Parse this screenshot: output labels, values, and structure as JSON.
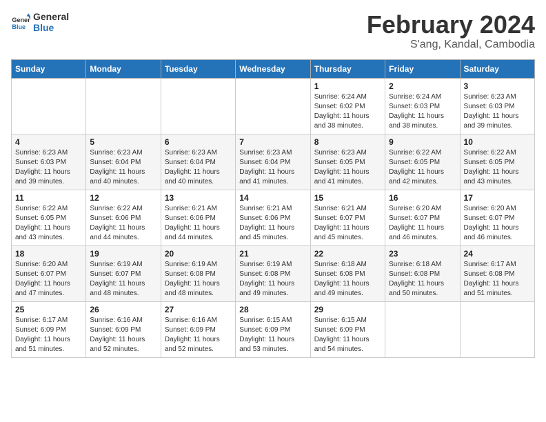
{
  "header": {
    "logo_line1": "General",
    "logo_line2": "Blue",
    "title": "February 2024",
    "subtitle": "S'ang, Kandal, Cambodia"
  },
  "calendar": {
    "days_of_week": [
      "Sunday",
      "Monday",
      "Tuesday",
      "Wednesday",
      "Thursday",
      "Friday",
      "Saturday"
    ],
    "weeks": [
      [
        {
          "day": "",
          "info": ""
        },
        {
          "day": "",
          "info": ""
        },
        {
          "day": "",
          "info": ""
        },
        {
          "day": "",
          "info": ""
        },
        {
          "day": "1",
          "info": "Sunrise: 6:24 AM\nSunset: 6:02 PM\nDaylight: 11 hours\nand 38 minutes."
        },
        {
          "day": "2",
          "info": "Sunrise: 6:24 AM\nSunset: 6:03 PM\nDaylight: 11 hours\nand 38 minutes."
        },
        {
          "day": "3",
          "info": "Sunrise: 6:23 AM\nSunset: 6:03 PM\nDaylight: 11 hours\nand 39 minutes."
        }
      ],
      [
        {
          "day": "4",
          "info": "Sunrise: 6:23 AM\nSunset: 6:03 PM\nDaylight: 11 hours\nand 39 minutes."
        },
        {
          "day": "5",
          "info": "Sunrise: 6:23 AM\nSunset: 6:04 PM\nDaylight: 11 hours\nand 40 minutes."
        },
        {
          "day": "6",
          "info": "Sunrise: 6:23 AM\nSunset: 6:04 PM\nDaylight: 11 hours\nand 40 minutes."
        },
        {
          "day": "7",
          "info": "Sunrise: 6:23 AM\nSunset: 6:04 PM\nDaylight: 11 hours\nand 41 minutes."
        },
        {
          "day": "8",
          "info": "Sunrise: 6:23 AM\nSunset: 6:05 PM\nDaylight: 11 hours\nand 41 minutes."
        },
        {
          "day": "9",
          "info": "Sunrise: 6:22 AM\nSunset: 6:05 PM\nDaylight: 11 hours\nand 42 minutes."
        },
        {
          "day": "10",
          "info": "Sunrise: 6:22 AM\nSunset: 6:05 PM\nDaylight: 11 hours\nand 43 minutes."
        }
      ],
      [
        {
          "day": "11",
          "info": "Sunrise: 6:22 AM\nSunset: 6:05 PM\nDaylight: 11 hours\nand 43 minutes."
        },
        {
          "day": "12",
          "info": "Sunrise: 6:22 AM\nSunset: 6:06 PM\nDaylight: 11 hours\nand 44 minutes."
        },
        {
          "day": "13",
          "info": "Sunrise: 6:21 AM\nSunset: 6:06 PM\nDaylight: 11 hours\nand 44 minutes."
        },
        {
          "day": "14",
          "info": "Sunrise: 6:21 AM\nSunset: 6:06 PM\nDaylight: 11 hours\nand 45 minutes."
        },
        {
          "day": "15",
          "info": "Sunrise: 6:21 AM\nSunset: 6:07 PM\nDaylight: 11 hours\nand 45 minutes."
        },
        {
          "day": "16",
          "info": "Sunrise: 6:20 AM\nSunset: 6:07 PM\nDaylight: 11 hours\nand 46 minutes."
        },
        {
          "day": "17",
          "info": "Sunrise: 6:20 AM\nSunset: 6:07 PM\nDaylight: 11 hours\nand 46 minutes."
        }
      ],
      [
        {
          "day": "18",
          "info": "Sunrise: 6:20 AM\nSunset: 6:07 PM\nDaylight: 11 hours\nand 47 minutes."
        },
        {
          "day": "19",
          "info": "Sunrise: 6:19 AM\nSunset: 6:07 PM\nDaylight: 11 hours\nand 48 minutes."
        },
        {
          "day": "20",
          "info": "Sunrise: 6:19 AM\nSunset: 6:08 PM\nDaylight: 11 hours\nand 48 minutes."
        },
        {
          "day": "21",
          "info": "Sunrise: 6:19 AM\nSunset: 6:08 PM\nDaylight: 11 hours\nand 49 minutes."
        },
        {
          "day": "22",
          "info": "Sunrise: 6:18 AM\nSunset: 6:08 PM\nDaylight: 11 hours\nand 49 minutes."
        },
        {
          "day": "23",
          "info": "Sunrise: 6:18 AM\nSunset: 6:08 PM\nDaylight: 11 hours\nand 50 minutes."
        },
        {
          "day": "24",
          "info": "Sunrise: 6:17 AM\nSunset: 6:08 PM\nDaylight: 11 hours\nand 51 minutes."
        }
      ],
      [
        {
          "day": "25",
          "info": "Sunrise: 6:17 AM\nSunset: 6:09 PM\nDaylight: 11 hours\nand 51 minutes."
        },
        {
          "day": "26",
          "info": "Sunrise: 6:16 AM\nSunset: 6:09 PM\nDaylight: 11 hours\nand 52 minutes."
        },
        {
          "day": "27",
          "info": "Sunrise: 6:16 AM\nSunset: 6:09 PM\nDaylight: 11 hours\nand 52 minutes."
        },
        {
          "day": "28",
          "info": "Sunrise: 6:15 AM\nSunset: 6:09 PM\nDaylight: 11 hours\nand 53 minutes."
        },
        {
          "day": "29",
          "info": "Sunrise: 6:15 AM\nSunset: 6:09 PM\nDaylight: 11 hours\nand 54 minutes."
        },
        {
          "day": "",
          "info": ""
        },
        {
          "day": "",
          "info": ""
        }
      ]
    ]
  }
}
